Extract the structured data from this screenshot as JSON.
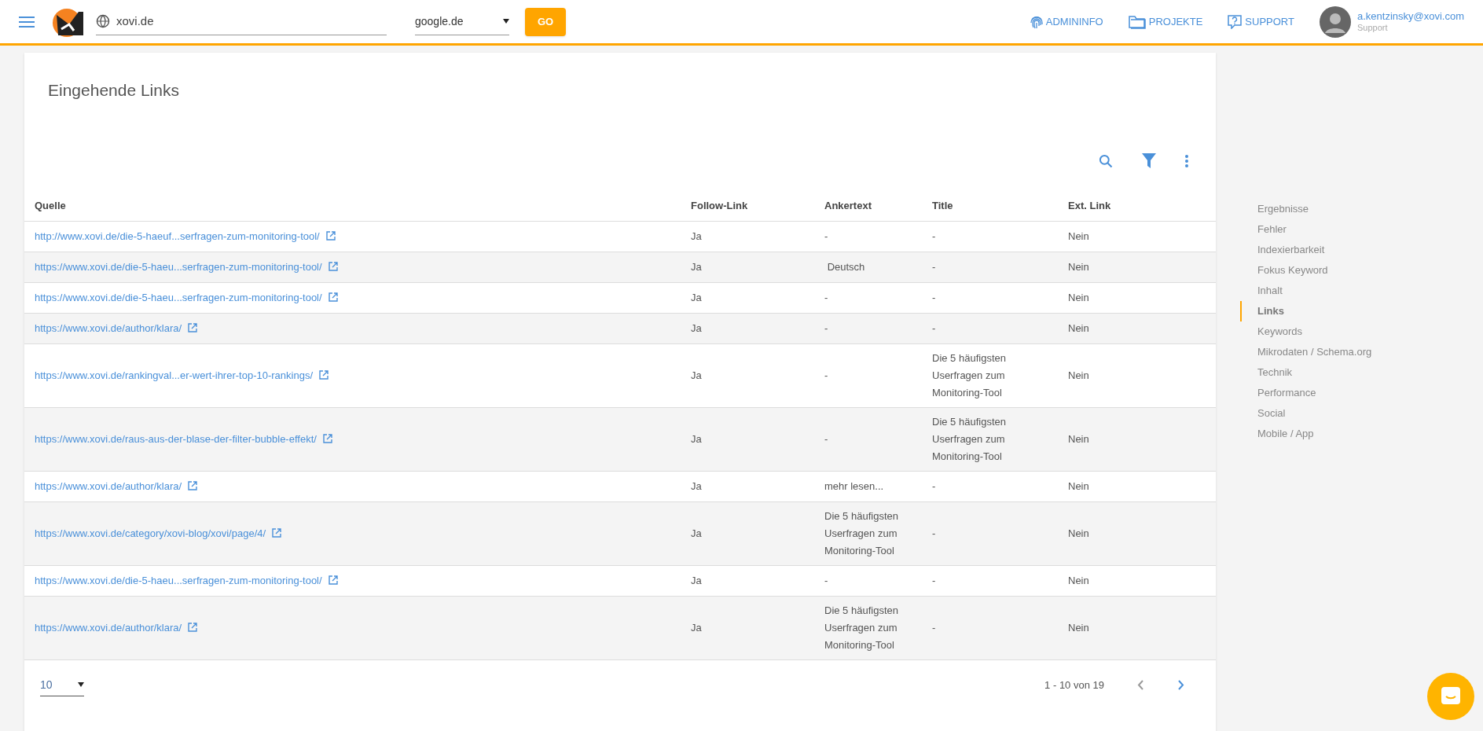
{
  "header": {
    "domain": "xovi.de",
    "engine": "google.de",
    "go_button": "GO",
    "nav": [
      {
        "label": "ADMININFO",
        "kind": "fingerprint"
      },
      {
        "label": "PROJEKTE",
        "kind": "folder"
      },
      {
        "label": "SUPPORT",
        "kind": "help"
      }
    ],
    "user": {
      "email": "a.kentzinsky@xovi.com",
      "role": "Support"
    }
  },
  "card": {
    "title": "Eingehende Links",
    "table": {
      "columns": [
        "Quelle",
        "Follow-Link",
        "Ankertext",
        "Title",
        "Ext. Link"
      ],
      "rows": [
        {
          "source": "http://www.xovi.de/die-5-haeuf...serfragen-zum-monitoring-tool/",
          "follow": "Ja",
          "anchor": "-",
          "title": "-",
          "ext": "Nein"
        },
        {
          "source": "https://www.xovi.de/die-5-haeu...serfragen-zum-monitoring-tool/",
          "follow": "Ja",
          "anchor": " Deutsch",
          "title": "-",
          "ext": "Nein"
        },
        {
          "source": "https://www.xovi.de/die-5-haeu...serfragen-zum-monitoring-tool/",
          "follow": "Ja",
          "anchor": "-",
          "title": "-",
          "ext": "Nein"
        },
        {
          "source": "https://www.xovi.de/author/klara/",
          "follow": "Ja",
          "anchor": "-",
          "title": "-",
          "ext": "Nein"
        },
        {
          "source": "https://www.xovi.de/rankingval...er-wert-ihrer-top-10-rankings/",
          "follow": "Ja",
          "anchor": "-",
          "title": "Die 5 häufigsten Userfragen zum Monitoring-Tool",
          "ext": "Nein"
        },
        {
          "source": "https://www.xovi.de/raus-aus-der-blase-der-filter-bubble-effekt/",
          "follow": "Ja",
          "anchor": "-",
          "title": "Die 5 häufigsten Userfragen zum Monitoring-Tool",
          "ext": "Nein"
        },
        {
          "source": "https://www.xovi.de/author/klara/",
          "follow": "Ja",
          "anchor": "mehr lesen...",
          "title": "-",
          "ext": "Nein"
        },
        {
          "source": "https://www.xovi.de/category/xovi-blog/xovi/page/4/",
          "follow": "Ja",
          "anchor": "Die 5 häufigsten Userfragen zum Monitoring-Tool",
          "title": "-",
          "ext": "Nein"
        },
        {
          "source": "https://www.xovi.de/die-5-haeu...serfragen-zum-monitoring-tool/",
          "follow": "Ja",
          "anchor": "-",
          "title": "-",
          "ext": "Nein"
        },
        {
          "source": "https://www.xovi.de/author/klara/",
          "follow": "Ja",
          "anchor": "Die 5 häufigsten Userfragen zum Monitoring-Tool",
          "title": "-",
          "ext": "Nein"
        }
      ]
    },
    "footer": {
      "page_size": "10",
      "range": "1 - 10 von 19",
      "prev_disabled": true,
      "next_disabled": false
    }
  },
  "sidebar": {
    "items": [
      {
        "label": "Ergebnisse",
        "selected": false
      },
      {
        "label": "Fehler",
        "selected": false
      },
      {
        "label": "Indexierbarkeit",
        "selected": false
      },
      {
        "label": "Fokus Keyword",
        "selected": false
      },
      {
        "label": "Inhalt",
        "selected": false
      },
      {
        "label": "Links",
        "selected": true
      },
      {
        "label": "Keywords",
        "selected": false
      },
      {
        "label": "Mikrodaten / Schema.org",
        "selected": false
      },
      {
        "label": "Technik",
        "selected": false
      },
      {
        "label": "Performance",
        "selected": false
      },
      {
        "label": "Social",
        "selected": false
      },
      {
        "label": "Mobile / App",
        "selected": false
      }
    ]
  }
}
